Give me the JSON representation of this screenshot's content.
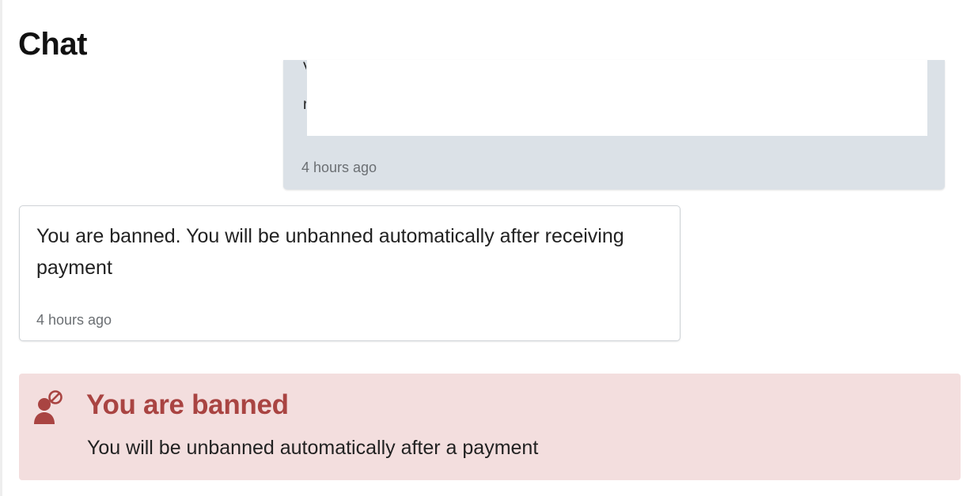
{
  "page": {
    "title": "Chat"
  },
  "messages": [
    {
      "direction": "outgoing",
      "text": "",
      "time": "4 hours ago"
    },
    {
      "direction": "incoming",
      "text": "You are banned. You will be unbanned automatically after receiving payment",
      "time": "4 hours ago"
    }
  ],
  "alert": {
    "icon": "user-banned-icon",
    "title": "You are banned",
    "text": "You will be unbanned automatically after a payment"
  },
  "colors": {
    "outgoing_bg": "#dbe1e7",
    "alert_bg": "#f3dede",
    "alert_title": "#a94442"
  }
}
